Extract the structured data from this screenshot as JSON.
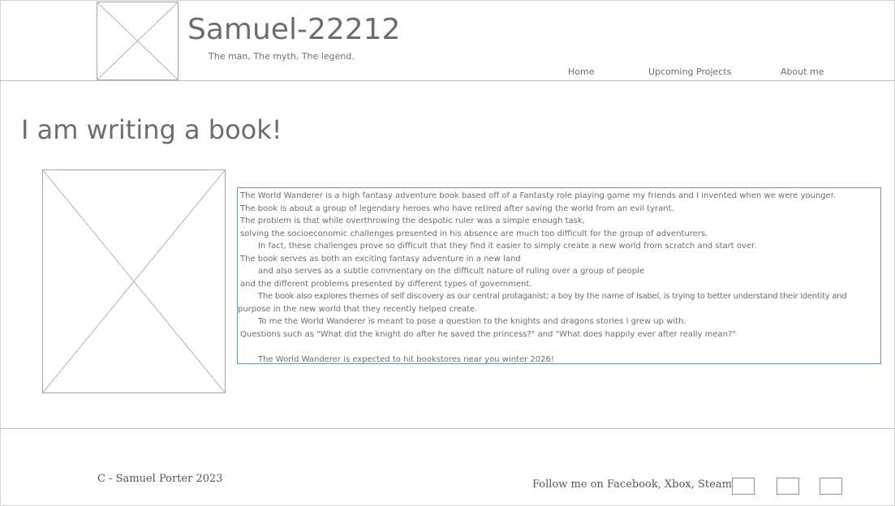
{
  "header": {
    "title": "Samuel-22212",
    "tagline": "The man, The myth, The legend.",
    "nav": [
      {
        "label": "Home"
      },
      {
        "label": "Upcoming Projects"
      },
      {
        "label": "About me"
      }
    ]
  },
  "main": {
    "heading": "I am writing a book!",
    "paragraph_lines": [
      "The World Wanderer is a high fantasy adventure book based off of a Fantasty role playing game my friends and I invented when we were younger.",
      "The book is about a group of legendary heroes who have retired after saving the world from an evil tyrant.",
      "The problem is that while overthrowing the despotic ruler was a simple enough task,",
      "solving the socioeconomic challenges presented in his absence are much too difficult for the group of adventurers.",
      "In fact, these challenges prove so difficult that they find it easier to simply create a new world from scratch and start over.",
      "The book serves as both an exciting fantasy adventure in a new land",
      "and also serves as a subtle commentary on the difficult nature of ruling over a group of people",
      "and the different problems presented by different types of government.",
      "The book also explores themes of self discovery as our central protaganist; a boy by the name of Isabel, is trying to better understand their identity and",
      "purpose in the new world that they recently helped create.",
      "To me the World Wanderer is meant to pose a question to the knights and dragons stories I grew up with.",
      "Questions such as \"What did the knight do after he saved the princess?\" and \"What does happily ever after really mean?\"",
      "",
      "The World Wanderer is expected to hit bookstores near you winter 2026!"
    ]
  },
  "footer": {
    "copyright": "C - Samuel Porter 2023",
    "follow": "Follow me on Facebook, Xbox, Steam",
    "social_icons": [
      "facebook-icon",
      "xbox-icon",
      "steam-icon"
    ]
  },
  "colors": {
    "text": "#6d6d6d",
    "divider": "#bdbdbd",
    "article_border": "#6f95b6",
    "placeholder_border": "#a8a8a8"
  }
}
